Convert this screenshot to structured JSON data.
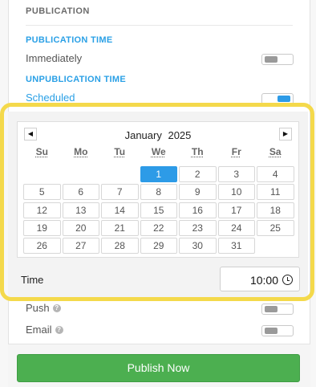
{
  "section": {
    "title": "PUBLICATION"
  },
  "publication_time": {
    "title": "PUBLICATION TIME",
    "label": "Immediately",
    "toggle_on": false
  },
  "unpublication_time": {
    "title": "UNPUBLICATION TIME",
    "label": "Scheduled",
    "toggle_on": true
  },
  "calendar": {
    "prev_label": "◀",
    "next_label": "▶",
    "month": "January",
    "year": "2025",
    "weekdays": [
      "Su",
      "Mo",
      "Tu",
      "We",
      "Th",
      "Fr",
      "Sa"
    ],
    "selected_day": "1",
    "weeks": [
      [
        "",
        "",
        "",
        "1",
        "2",
        "3",
        "4"
      ],
      [
        "5",
        "6",
        "7",
        "8",
        "9",
        "10",
        "11"
      ],
      [
        "12",
        "13",
        "14",
        "15",
        "16",
        "17",
        "18"
      ],
      [
        "19",
        "20",
        "21",
        "22",
        "23",
        "24",
        "25"
      ],
      [
        "26",
        "27",
        "28",
        "29",
        "30",
        "31",
        ""
      ]
    ]
  },
  "time": {
    "label": "Time",
    "value": "10:00"
  },
  "push": {
    "label": "Push",
    "help": "?",
    "toggle_on": false
  },
  "email": {
    "label": "Email",
    "help": "?",
    "toggle_on": false
  },
  "publish_button": {
    "label": "Publish Now"
  },
  "colors": {
    "accent": "#2d9be7",
    "highlight": "#f4d94b",
    "publish": "#4caf50"
  }
}
